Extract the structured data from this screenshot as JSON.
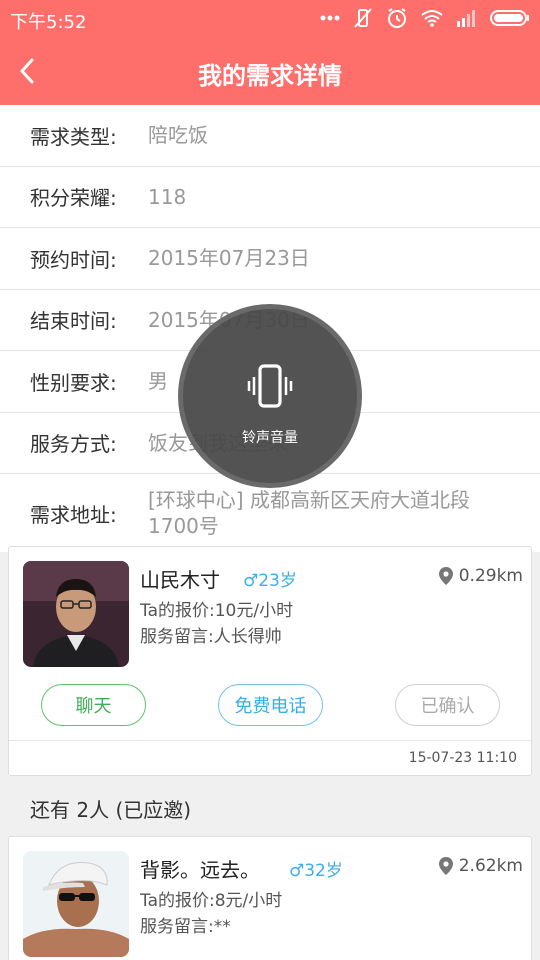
{
  "status": {
    "time": "下午5:52"
  },
  "header": {
    "title": "我的需求详情"
  },
  "details": [
    {
      "label": "需求类型:",
      "value": "陪吃饭"
    },
    {
      "label": "积分荣耀:",
      "value": "118"
    },
    {
      "label": "预约时间:",
      "value": "2015年07月23日"
    },
    {
      "label": "结束时间:",
      "value": "2015年07月30日"
    },
    {
      "label": "性别要求:",
      "value": "男"
    },
    {
      "label": "服务方式:",
      "value": "饭友到我这里来"
    },
    {
      "label": "需求地址:",
      "value": "[环球中心] 成都高新区天府大道北段1700号"
    }
  ],
  "confirmed": {
    "name": "山民木寸",
    "gender_age": "♂23岁",
    "distance": "0.29km",
    "price": "Ta的报价:10元/小时",
    "message": "服务留言:人长得帅",
    "btn_chat": "聊天",
    "btn_call": "免费电话",
    "btn_status": "已确认",
    "timestamp": "15-07-23 11:10"
  },
  "others_header": "还有 2人 (已应邀)",
  "others": [
    {
      "name": "背影。远去。",
      "gender_age": "♂32岁",
      "distance": "2.62km",
      "price": "Ta的报价:8元/小时",
      "message": "服务留言:**"
    }
  ],
  "volume_toast": {
    "label": "铃声音量",
    "icon": "vibrate-icon"
  },
  "colors": {
    "header": "#fe6e6b",
    "chat": "#3fae55",
    "call": "#3aaee8",
    "gender": "#3aaee8"
  }
}
